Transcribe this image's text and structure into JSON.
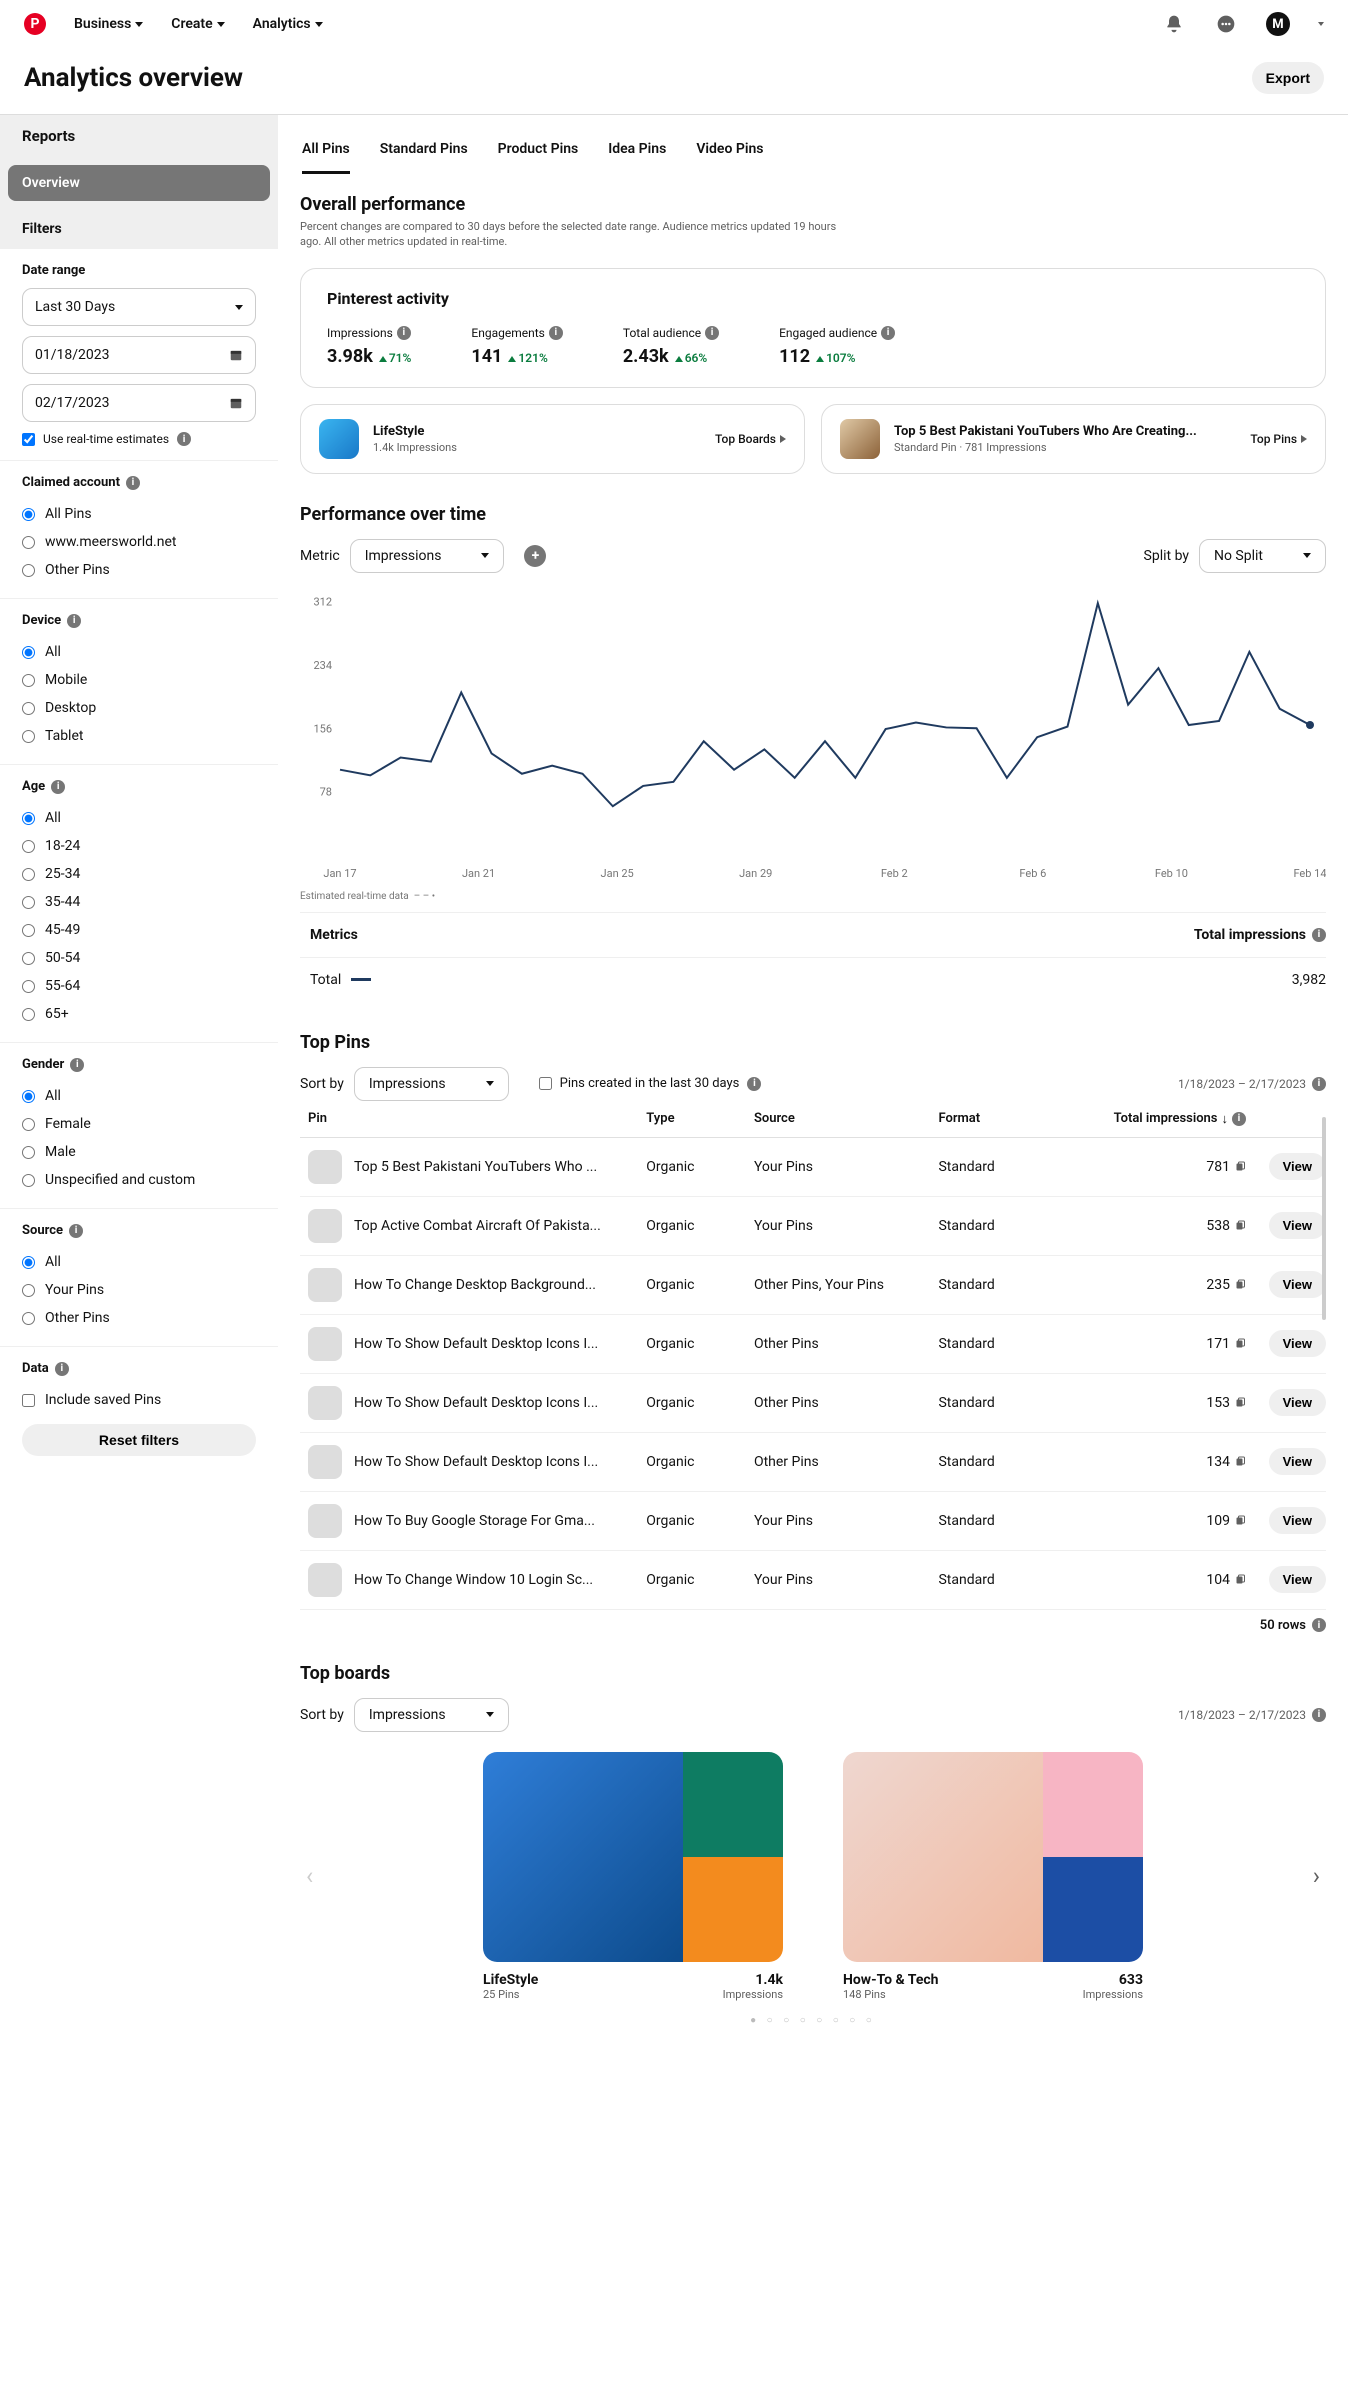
{
  "topnav": {
    "business": "Business",
    "create": "Create",
    "analytics": "Analytics",
    "avatar_initial": "M"
  },
  "page": {
    "title": "Analytics overview",
    "export": "Export"
  },
  "sidebar": {
    "reports": "Reports",
    "overview": "Overview",
    "filters": "Filters",
    "date_range_label": "Date range",
    "date_range_value": "Last 30 Days",
    "date_from": "01/18/2023",
    "date_to": "02/17/2023",
    "realtime": "Use real-time estimates",
    "claimed_label": "Claimed account",
    "claimed": {
      "all": "All Pins",
      "site": "www.meersworld.net",
      "other": "Other Pins"
    },
    "device_label": "Device",
    "device": {
      "all": "All",
      "mobile": "Mobile",
      "desktop": "Desktop",
      "tablet": "Tablet"
    },
    "age_label": "Age",
    "age": {
      "all": "All",
      "a1": "18-24",
      "a2": "25-34",
      "a3": "35-44",
      "a4": "45-49",
      "a5": "50-54",
      "a6": "55-64",
      "a7": "65+"
    },
    "gender_label": "Gender",
    "gender": {
      "all": "All",
      "female": "Female",
      "male": "Male",
      "unspec": "Unspecified and custom"
    },
    "source_label": "Source",
    "source": {
      "all": "All",
      "your": "Your Pins",
      "other": "Other Pins"
    },
    "data_label": "Data",
    "include_saved": "Include saved Pins",
    "reset": "Reset filters"
  },
  "tabs": [
    "All Pins",
    "Standard Pins",
    "Product Pins",
    "Idea Pins",
    "Video Pins"
  ],
  "overall": {
    "heading": "Overall performance",
    "sub": "Percent changes are compared to 30 days before the selected date range. Audience metrics updated 19 hours ago. All other metrics updated in real-time.",
    "card_title": "Pinterest activity",
    "metrics": [
      {
        "label": "Impressions",
        "value": "3.98k",
        "delta": "71%"
      },
      {
        "label": "Engagements",
        "value": "141",
        "delta": "121%"
      },
      {
        "label": "Total audience",
        "value": "2.43k",
        "delta": "66%"
      },
      {
        "label": "Engaged audience",
        "value": "112",
        "delta": "107%"
      }
    ],
    "topboard": {
      "title": "LifeStyle",
      "sub": "1.4k Impressions",
      "link": "Top Boards"
    },
    "toppin": {
      "title": "Top 5 Best Pakistani YouTubers Who Are Creating...",
      "sub": "Standard Pin · 781 Impressions",
      "link": "Top Pins"
    }
  },
  "perf": {
    "heading": "Performance over time",
    "metric_label": "Metric",
    "metric_value": "Impressions",
    "split_label": "Split by",
    "split_value": "No Split",
    "realtime_note": "Estimated real-time data",
    "metrics_label": "Metrics",
    "total_imp_label": "Total impressions",
    "total_label": "Total",
    "total_value": "3,982"
  },
  "chart_data": {
    "type": "line",
    "xlabel": "",
    "ylabel": "",
    "ylim": [
      0,
      320
    ],
    "y_ticks": [
      78,
      156,
      234,
      312
    ],
    "x_ticks": [
      "Jan 17",
      "Jan 21",
      "Jan 25",
      "Jan 29",
      "Feb 2",
      "Feb 6",
      "Feb 10",
      "Feb 14"
    ],
    "series": [
      {
        "name": "Impressions",
        "values": [
          105,
          98,
          120,
          115,
          200,
          125,
          100,
          110,
          100,
          60,
          85,
          90,
          140,
          105,
          130,
          95,
          140,
          95,
          155,
          163,
          157,
          156,
          95,
          145,
          158,
          310,
          185,
          230,
          160,
          165,
          250,
          180,
          160
        ]
      }
    ]
  },
  "top_pins": {
    "heading": "Top Pins",
    "sort_label": "Sort by",
    "sort_value": "Impressions",
    "created_filter": "Pins created in the last 30 days",
    "date_range": "1/18/2023 – 2/17/2023",
    "cols": {
      "pin": "Pin",
      "type": "Type",
      "source": "Source",
      "format": "Format",
      "impressions": "Total impressions"
    },
    "view": "View",
    "rows_text": "50 rows",
    "rows": [
      {
        "title": "Top 5 Best Pakistani YouTubers Who ...",
        "type": "Organic",
        "source": "Your Pins",
        "format": "Standard",
        "imp": "781"
      },
      {
        "title": "Top Active Combat Aircraft Of Pakista...",
        "type": "Organic",
        "source": "Your Pins",
        "format": "Standard",
        "imp": "538"
      },
      {
        "title": "How To Change Desktop Background...",
        "type": "Organic",
        "source": "Other Pins, Your Pins",
        "format": "Standard",
        "imp": "235"
      },
      {
        "title": "How To Show Default Desktop Icons I...",
        "type": "Organic",
        "source": "Other Pins",
        "format": "Standard",
        "imp": "171"
      },
      {
        "title": "How To Show Default Desktop Icons I...",
        "type": "Organic",
        "source": "Other Pins",
        "format": "Standard",
        "imp": "153"
      },
      {
        "title": "How To Show Default Desktop Icons I...",
        "type": "Organic",
        "source": "Other Pins",
        "format": "Standard",
        "imp": "134"
      },
      {
        "title": "How To Buy Google Storage For Gma...",
        "type": "Organic",
        "source": "Your Pins",
        "format": "Standard",
        "imp": "109"
      },
      {
        "title": "How To Change Window 10 Login Sc...",
        "type": "Organic",
        "source": "Your Pins",
        "format": "Standard",
        "imp": "104"
      }
    ]
  },
  "top_boards": {
    "heading": "Top boards",
    "sort_label": "Sort by",
    "sort_value": "Impressions",
    "date_range": "1/18/2023 – 2/17/2023",
    "boards": [
      {
        "name": "LifeStyle",
        "pins": "25 Pins",
        "value": "1.4k",
        "unit": "Impressions"
      },
      {
        "name": "How-To & Tech",
        "pins": "148 Pins",
        "value": "633",
        "unit": "Impressions"
      }
    ]
  }
}
